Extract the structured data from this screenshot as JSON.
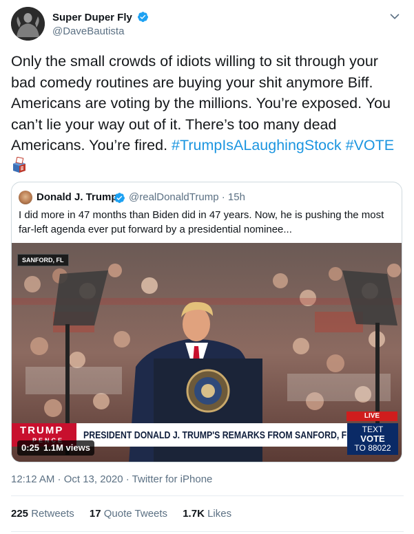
{
  "tweet": {
    "display_name": "Super Duper Fly",
    "handle": "@DaveBautista",
    "body_text": "Only the small crowds of idiots willing to sit through your bad comedy routines are buying your shit anymore Biff. Americans are voting by the millions. You’re exposed. You can’t lie your way out of it. There’s too many dead Americans. You’re fired.",
    "hashtag_1": "#TrumpIsALaughingStock",
    "hashtag_2": "#VOTE",
    "timestamp": "12:12 AM · Oct 13, 2020 · Twitter for iPhone"
  },
  "quoted_tweet": {
    "display_name": "Donald J. Trump",
    "handle_time": "@realDonaldTrump · 15h",
    "text": "I did more in 47 months than Biden did in 47 years. Now, he is pushing the most far-left agenda ever put forward by a presidential nominee...",
    "video": {
      "location_tag": "SANFORD, FL",
      "live_label": "LIVE",
      "logo_line1": "TRUMP",
      "logo_line2": "PENCE",
      "chyron": "PRESIDENT DONALD J. TRUMP'S REMARKS FROM SANFORD, FL",
      "text_vote_line1": "TEXT",
      "text_vote_line2": "VOTE",
      "text_vote_line3": "TO 88022",
      "duration": "0:25",
      "views": "1.1M views"
    }
  },
  "stats": {
    "retweets_count": "225",
    "retweets_label": "Retweets",
    "quote_count": "17",
    "quote_label": "Quote Tweets",
    "likes_count": "1.7K",
    "likes_label": "Likes"
  },
  "icons": {
    "verified": "verified-badge-icon",
    "menu": "chevron-down-icon",
    "emoji": "ballot-box-icon"
  },
  "colors": {
    "link": "#1b95e0",
    "verified": "#1da1f2",
    "secondary_text": "#5b7083"
  }
}
